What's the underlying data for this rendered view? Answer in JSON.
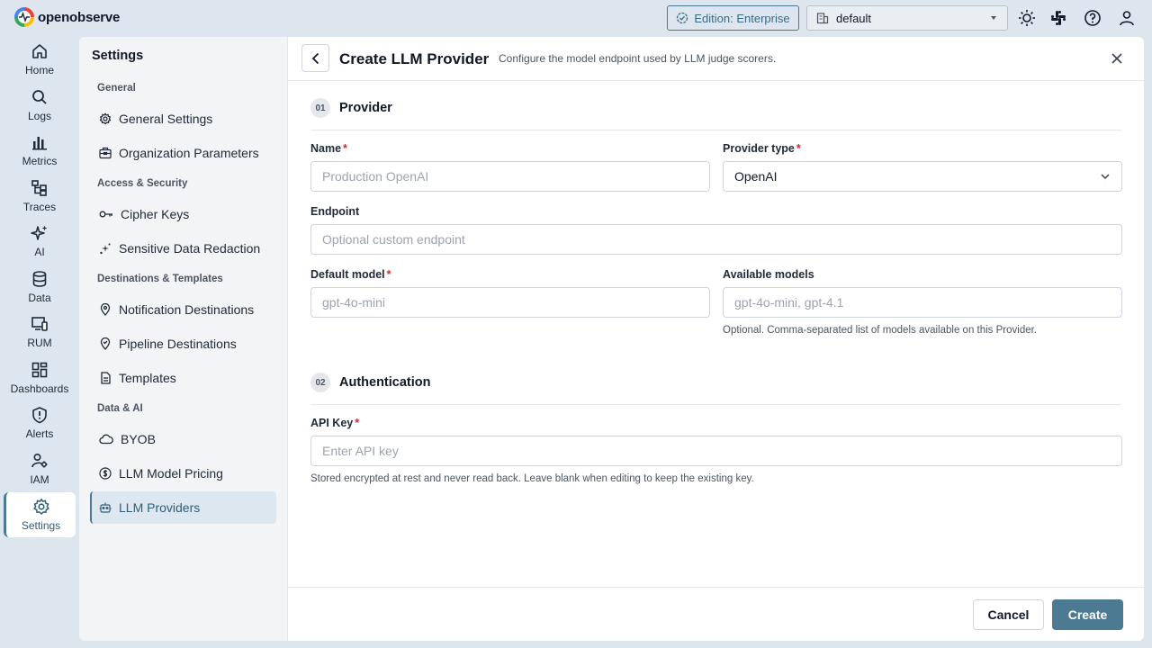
{
  "app": {
    "logo_text": "openobserve"
  },
  "topbar": {
    "edition_label": "Edition: Enterprise",
    "org_selected": "default",
    "icons": [
      "theme-toggle-icon",
      "slack-icon",
      "help-icon",
      "user-icon"
    ]
  },
  "nav": {
    "items": [
      {
        "label": "Home",
        "icon": "home-icon"
      },
      {
        "label": "Logs",
        "icon": "search-icon"
      },
      {
        "label": "Metrics",
        "icon": "bar-chart-icon"
      },
      {
        "label": "Traces",
        "icon": "traces-icon"
      },
      {
        "label": "AI",
        "icon": "sparkle-icon"
      },
      {
        "label": "Data",
        "icon": "database-icon"
      },
      {
        "label": "RUM",
        "icon": "devices-icon"
      },
      {
        "label": "Dashboards",
        "icon": "dashboard-icon"
      },
      {
        "label": "Alerts",
        "icon": "shield-alert-icon"
      },
      {
        "label": "IAM",
        "icon": "users-cog-icon"
      },
      {
        "label": "Settings",
        "icon": "gear-icon"
      }
    ],
    "active": "Settings"
  },
  "settings": {
    "title": "Settings",
    "sections": [
      {
        "label": "General",
        "items": [
          "General Settings",
          "Organization Parameters"
        ]
      },
      {
        "label": "Access & Security",
        "items": [
          "Cipher Keys",
          "Sensitive Data Redaction"
        ]
      },
      {
        "label": "Destinations & Templates",
        "items": [
          "Notification Destinations",
          "Pipeline Destinations",
          "Templates"
        ]
      },
      {
        "label": "Data & AI",
        "items": [
          "BYOB",
          "LLM Model Pricing",
          "LLM Providers"
        ]
      }
    ],
    "active_item": "LLM Providers"
  },
  "form": {
    "title": "Create LLM Provider",
    "subtitle": "Configure the model endpoint used by LLM judge scorers.",
    "step1": {
      "num": "01",
      "title": "Provider"
    },
    "step2": {
      "num": "02",
      "title": "Authentication"
    },
    "name": {
      "label": "Name",
      "required": "*",
      "placeholder": "Production OpenAI",
      "value": ""
    },
    "provider_type": {
      "label": "Provider type",
      "required": "*",
      "selected": "OpenAI"
    },
    "endpoint": {
      "label": "Endpoint",
      "placeholder": "Optional custom endpoint",
      "value": ""
    },
    "default_model": {
      "label": "Default model",
      "required": "*",
      "placeholder": "gpt-4o-mini",
      "value": ""
    },
    "available_models": {
      "label": "Available models",
      "placeholder": "gpt-4o-mini, gpt-4.1",
      "value": "",
      "hint": "Optional. Comma-separated list of models available on this Provider."
    },
    "api_key": {
      "label": "API Key",
      "required": "*",
      "placeholder": "Enter API key",
      "value": "",
      "hint": "Stored encrypted at rest and never read back. Leave blank when editing to keep the existing key."
    },
    "cancel_label": "Cancel",
    "create_label": "Create"
  },
  "colors": {
    "accent": "#4c7a93",
    "background": "#dde6ef",
    "required": "#dc2626"
  }
}
